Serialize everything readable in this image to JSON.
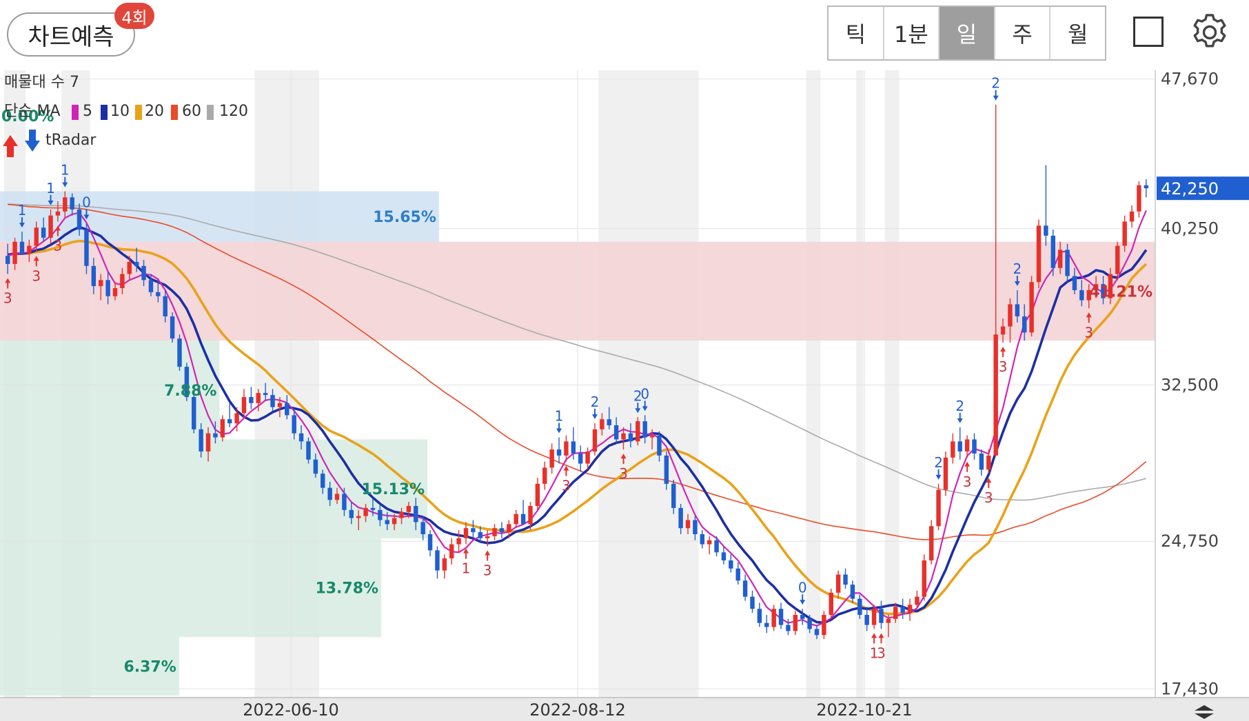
{
  "header": {
    "title": "차트예측",
    "badge": "4회",
    "periods": [
      "틱",
      "1분",
      "일",
      "주",
      "월"
    ],
    "active_period": "일",
    "square_icon": "square-icon",
    "settings_icon": "gear-icon"
  },
  "colors": {
    "up": "#e8302a",
    "down": "#1f5fd0",
    "ma5": "#d024b8",
    "ma10": "#1c2fa4",
    "ma20": "#e9a21a",
    "ma60": "#ea4a26",
    "ma120": "#aaaaaa",
    "zone_blue": "#cfe0f2",
    "zone_red": "#f3d4d6",
    "zone_green": "#d7ebe2",
    "price_tag": "#1f5fd0"
  },
  "chart_data": {
    "type": "candlestick",
    "indicator_labels": {
      "volume_profile": "매물대 수 7",
      "ma_title": "단순 MA",
      "ma_periods": [
        "5",
        "10",
        "20",
        "60",
        "120"
      ],
      "radar": "tRadar"
    },
    "y_ticks": [
      "47,670",
      "40,250",
      "32,500",
      "24,750",
      "17,430"
    ],
    "y_tick_values": [
      47670,
      40250,
      32500,
      24750,
      17430
    ],
    "current_price": 42250,
    "current_price_label": "42,250",
    "x_labels": [
      "2022-06-10",
      "2022-08-12",
      "2022-10-21"
    ],
    "volume_zones": [
      {
        "label": "15.65%",
        "from": 39600,
        "to": 42100,
        "kind": "blue"
      },
      {
        "label": "41.21%",
        "from": 34700,
        "to": 39600,
        "kind": "red"
      },
      {
        "label": "7.88%",
        "from": 29800,
        "to": 34700,
        "kind": "green"
      },
      {
        "label": "15.13%",
        "from": 24900,
        "to": 29800,
        "kind": "green"
      },
      {
        "label": "13.78%",
        "from": 20000,
        "to": 24900,
        "kind": "green"
      },
      {
        "label": "6.37%",
        "from": 17100,
        "to": 20000,
        "kind": "green"
      },
      {
        "label": "0.00%",
        "from": 42100,
        "to": 47670,
        "kind": "none"
      }
    ],
    "candles": [
      [
        38900,
        39500,
        38000,
        38500
      ],
      [
        38500,
        39800,
        38200,
        39600
      ],
      [
        39600,
        40100,
        39200,
        39000
      ],
      [
        39000,
        39700,
        38600,
        39400
      ],
      [
        39400,
        40600,
        39100,
        40300
      ],
      [
        40300,
        40800,
        39600,
        39800
      ],
      [
        39800,
        41200,
        39500,
        40900
      ],
      [
        40900,
        41600,
        40600,
        41100
      ],
      [
        41100,
        42100,
        40800,
        41800
      ],
      [
        41800,
        42000,
        40900,
        41200
      ],
      [
        41200,
        41500,
        39900,
        40200
      ],
      [
        40200,
        40500,
        38000,
        38400
      ],
      [
        38400,
        38800,
        37000,
        37400
      ],
      [
        37400,
        38000,
        36700,
        37700
      ],
      [
        37700,
        38100,
        36500,
        36900
      ],
      [
        36900,
        37600,
        36700,
        37300
      ],
      [
        37300,
        38300,
        37000,
        38000
      ],
      [
        38000,
        38900,
        37700,
        38600
      ],
      [
        38600,
        39300,
        38100,
        38400
      ],
      [
        38400,
        38700,
        37400,
        37700
      ],
      [
        37700,
        38000,
        36900,
        37100
      ],
      [
        37100,
        37700,
        36600,
        36900
      ],
      [
        36900,
        37200,
        35600,
        35900
      ],
      [
        35900,
        36100,
        34600,
        34800
      ],
      [
        34800,
        35000,
        33200,
        33400
      ],
      [
        33400,
        33600,
        31700,
        31900
      ],
      [
        31900,
        32100,
        30100,
        30300
      ],
      [
        30300,
        30600,
        28900,
        29200
      ],
      [
        29200,
        30400,
        28700,
        30100
      ],
      [
        30100,
        30700,
        29600,
        29900
      ],
      [
        29900,
        31000,
        29700,
        30800
      ],
      [
        30800,
        31600,
        30400,
        30600
      ],
      [
        30600,
        31400,
        30200,
        31100
      ],
      [
        31100,
        32300,
        30900,
        31900
      ],
      [
        31900,
        32400,
        31300,
        31600
      ],
      [
        31600,
        32300,
        31200,
        32100
      ],
      [
        32100,
        32600,
        31700,
        32000
      ],
      [
        32000,
        32300,
        31200,
        31400
      ],
      [
        31400,
        31900,
        30900,
        31600
      ],
      [
        31600,
        32000,
        30800,
        31000
      ],
      [
        31000,
        31300,
        29800,
        30100
      ],
      [
        30100,
        30500,
        29300,
        29700
      ],
      [
        29700,
        29900,
        28600,
        28800
      ],
      [
        28800,
        29100,
        27900,
        28100
      ],
      [
        28100,
        28300,
        27100,
        27400
      ],
      [
        27400,
        27700,
        26500,
        26800
      ],
      [
        26800,
        27400,
        26600,
        27100
      ],
      [
        27100,
        27400,
        26000,
        26300
      ],
      [
        26300,
        26700,
        25600,
        25900
      ],
      [
        25900,
        26300,
        25300,
        26000
      ],
      [
        26000,
        26600,
        25700,
        26400
      ],
      [
        26400,
        26900,
        26000,
        26300
      ],
      [
        26300,
        26600,
        25500,
        25800
      ],
      [
        25800,
        26200,
        25300,
        25600
      ],
      [
        25600,
        26100,
        25300,
        25900
      ],
      [
        25900,
        26400,
        25600,
        26200
      ],
      [
        26200,
        26700,
        25900,
        26500
      ],
      [
        26500,
        26900,
        25300,
        25700
      ],
      [
        25700,
        26000,
        24800,
        25100
      ],
      [
        25100,
        25300,
        24000,
        24300
      ],
      [
        24300,
        24500,
        22900,
        23300
      ],
      [
        23300,
        24100,
        22900,
        23900
      ],
      [
        23900,
        24900,
        23600,
        24600
      ],
      [
        24600,
        25300,
        24200,
        24900
      ],
      [
        24900,
        25700,
        24600,
        25400
      ],
      [
        25400,
        25800,
        24900,
        25200
      ],
      [
        25200,
        25500,
        24700,
        24900
      ],
      [
        24900,
        25300,
        24500,
        25000
      ],
      [
        25000,
        25600,
        24800,
        25400
      ],
      [
        25400,
        25700,
        24900,
        25200
      ],
      [
        25200,
        25800,
        24900,
        25600
      ],
      [
        25600,
        26300,
        25400,
        26100
      ],
      [
        26100,
        26800,
        25800,
        25600
      ],
      [
        25600,
        26700,
        25300,
        26500
      ],
      [
        26500,
        27900,
        26300,
        27600
      ],
      [
        27600,
        28700,
        27300,
        28400
      ],
      [
        28400,
        29600,
        28100,
        29300
      ],
      [
        29300,
        29900,
        28600,
        29000
      ],
      [
        29000,
        30000,
        28700,
        29700
      ],
      [
        29700,
        30400,
        28800,
        29100
      ],
      [
        29100,
        29500,
        28200,
        28600
      ],
      [
        28600,
        29400,
        28300,
        29200
      ],
      [
        29200,
        30600,
        29000,
        30300
      ],
      [
        30300,
        31100,
        30000,
        30800
      ],
      [
        30800,
        31400,
        30300,
        30500
      ],
      [
        30500,
        30900,
        29600,
        29800
      ],
      [
        29800,
        30400,
        29300,
        30100
      ],
      [
        30100,
        30600,
        29400,
        29700
      ],
      [
        29700,
        30900,
        29500,
        30700
      ],
      [
        30700,
        31000,
        29600,
        29900
      ],
      [
        29900,
        30300,
        29300,
        30000
      ],
      [
        30000,
        30200,
        28700,
        29000
      ],
      [
        29000,
        29200,
        27300,
        27600
      ],
      [
        27600,
        27800,
        26100,
        26400
      ],
      [
        26400,
        26600,
        25100,
        25400
      ],
      [
        25400,
        26100,
        25100,
        25800
      ],
      [
        25800,
        26000,
        24800,
        25100
      ],
      [
        25100,
        25300,
        24400,
        24600
      ],
      [
        24600,
        25000,
        24100,
        24800
      ],
      [
        24800,
        25000,
        24000,
        24200
      ],
      [
        24200,
        24500,
        23600,
        23800
      ],
      [
        23800,
        24100,
        23200,
        23400
      ],
      [
        23400,
        23700,
        22600,
        22800
      ],
      [
        22800,
        23100,
        21800,
        22000
      ],
      [
        22000,
        22300,
        21200,
        21400
      ],
      [
        21400,
        21700,
        20500,
        20700
      ],
      [
        20700,
        21100,
        20200,
        20500
      ],
      [
        20500,
        21600,
        20300,
        21400
      ],
      [
        21400,
        21700,
        20400,
        20600
      ],
      [
        20600,
        20900,
        20100,
        20300
      ],
      [
        20300,
        21300,
        20100,
        21100
      ],
      [
        21100,
        21400,
        20600,
        20900
      ],
      [
        20900,
        21100,
        20200,
        20400
      ],
      [
        20400,
        20600,
        19900,
        20100
      ],
      [
        20100,
        21300,
        19900,
        21100
      ],
      [
        21100,
        22400,
        20900,
        22200
      ],
      [
        22200,
        23300,
        21900,
        23100
      ],
      [
        23100,
        23400,
        22400,
        22600
      ],
      [
        22600,
        22800,
        21700,
        21900
      ],
      [
        21900,
        22100,
        20900,
        21100
      ],
      [
        21100,
        21500,
        20300,
        20600
      ],
      [
        20600,
        21600,
        20400,
        21400
      ],
      [
        21400,
        21800,
        20400,
        20700
      ],
      [
        20700,
        21100,
        20000,
        20900
      ],
      [
        20900,
        21700,
        20700,
        21500
      ],
      [
        21500,
        21900,
        20900,
        21200
      ],
      [
        21200,
        21900,
        20800,
        21600
      ],
      [
        21600,
        22300,
        21400,
        22000
      ],
      [
        22000,
        24100,
        21800,
        23800
      ],
      [
        23800,
        25800,
        23600,
        25500
      ],
      [
        25500,
        27600,
        25300,
        27300
      ],
      [
        27300,
        29200,
        27000,
        28900
      ],
      [
        28900,
        30100,
        28600,
        29700
      ],
      [
        29700,
        30400,
        28800,
        29200
      ],
      [
        29200,
        30000,
        28900,
        29800
      ],
      [
        29800,
        30100,
        28800,
        29100
      ],
      [
        29100,
        29300,
        28000,
        28300
      ],
      [
        28300,
        29300,
        28100,
        29000
      ],
      [
        29000,
        46400,
        34800,
        35000
      ],
      [
        35000,
        35800,
        34600,
        35400
      ],
      [
        35400,
        36800,
        34600,
        36500
      ],
      [
        36500,
        37200,
        35600,
        35900
      ],
      [
        35900,
        36500,
        34700,
        35100
      ],
      [
        35100,
        37900,
        34900,
        37600
      ],
      [
        37600,
        40700,
        37300,
        40400
      ],
      [
        40400,
        43400,
        39400,
        39900
      ],
      [
        39900,
        40200,
        37900,
        38300
      ],
      [
        38300,
        39600,
        38000,
        39200
      ],
      [
        39200,
        39500,
        37600,
        37900
      ],
      [
        37900,
        38300,
        37000,
        37200
      ],
      [
        37200,
        37700,
        36400,
        36700
      ],
      [
        36700,
        37500,
        36300,
        37200
      ],
      [
        37200,
        37900,
        36800,
        37500
      ],
      [
        37500,
        37900,
        36500,
        36800
      ],
      [
        36800,
        38300,
        36500,
        38000
      ],
      [
        38000,
        39600,
        37700,
        39400
      ],
      [
        39400,
        40900,
        39100,
        40600
      ],
      [
        40600,
        41400,
        40300,
        41100
      ],
      [
        41100,
        42600,
        40800,
        42400
      ],
      [
        42400,
        42700,
        41800,
        42250
      ]
    ],
    "radar_markers": [
      {
        "i": 2,
        "dir": "down",
        "label": "1"
      },
      {
        "i": 6,
        "dir": "down",
        "label": "1"
      },
      {
        "i": 8,
        "dir": "down",
        "label": "1"
      },
      {
        "i": 11,
        "dir": "down",
        "label": "0"
      },
      {
        "i": 0,
        "dir": "up",
        "label": "3"
      },
      {
        "i": 4,
        "dir": "up",
        "label": "3"
      },
      {
        "i": 7,
        "dir": "up",
        "label": "3"
      },
      {
        "i": 64,
        "dir": "up",
        "label": "1"
      },
      {
        "i": 67,
        "dir": "up",
        "label": "3"
      },
      {
        "i": 78,
        "dir": "up",
        "label": "3"
      },
      {
        "i": 77,
        "dir": "down",
        "label": "1"
      },
      {
        "i": 82,
        "dir": "down",
        "label": "2"
      },
      {
        "i": 86,
        "dir": "up",
        "label": "3"
      },
      {
        "i": 88,
        "dir": "down",
        "label": "2"
      },
      {
        "i": 89,
        "dir": "down",
        "label": "0"
      },
      {
        "i": 111,
        "dir": "down",
        "label": "0"
      },
      {
        "i": 121,
        "dir": "up",
        "label": "1"
      },
      {
        "i": 122,
        "dir": "up",
        "label": "3"
      },
      {
        "i": 130,
        "dir": "down",
        "label": "2"
      },
      {
        "i": 133,
        "dir": "down",
        "label": "2"
      },
      {
        "i": 134,
        "dir": "up",
        "label": "3"
      },
      {
        "i": 137,
        "dir": "up",
        "label": "3"
      },
      {
        "i": 138,
        "dir": "down",
        "label": "2"
      },
      {
        "i": 139,
        "dir": "up",
        "label": "3"
      },
      {
        "i": 141,
        "dir": "down",
        "label": "2"
      },
      {
        "i": 151,
        "dir": "up",
        "label": "3"
      }
    ],
    "highlight_bands": [
      [
        0,
        2
      ],
      [
        8,
        11
      ],
      [
        35,
        43
      ],
      [
        83,
        96
      ],
      [
        112,
        113
      ],
      [
        119,
        119
      ],
      [
        123,
        124
      ]
    ]
  }
}
